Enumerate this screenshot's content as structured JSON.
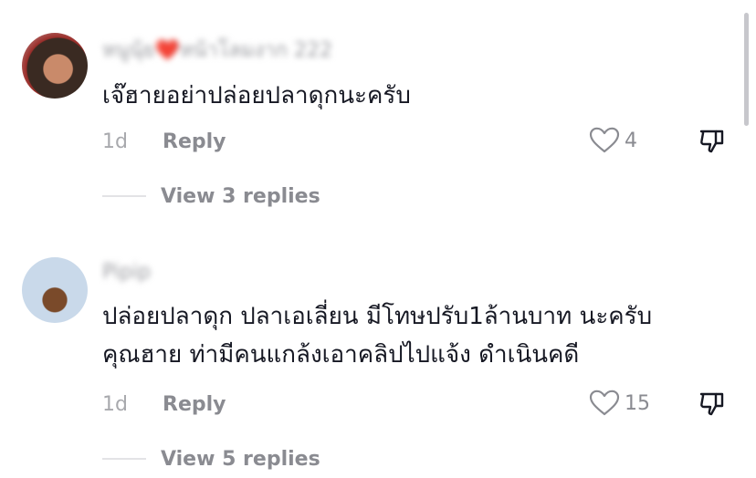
{
  "comments": [
    {
      "username": "หนูนุ้ย❤️หน้าโลมงาก 222",
      "text": "เจ๊ฮายอย่าปล่อยปลาดุกนะครับ",
      "time": "1d",
      "reply_label": "Reply",
      "likes": "4",
      "view_replies": "View 3 replies"
    },
    {
      "username": "Pipip",
      "text": "ปล่อยปลาดุก ปลาเอเลี่ยน มีโทษปรับ1ล้านบาท นะครับ\nคุณฮาย ท่ามีคนแกล้งเอาคลิปไปแจ้ง ดำเนินคดี",
      "time": "1d",
      "reply_label": "Reply",
      "likes": "15",
      "view_replies": "View 5 replies"
    }
  ],
  "icons": {
    "heart": "heart-outline-icon",
    "dislike": "thumbs-down-icon"
  },
  "colors": {
    "text": "#161823",
    "muted": "#8a8b91",
    "time": "#a8a9ad"
  }
}
